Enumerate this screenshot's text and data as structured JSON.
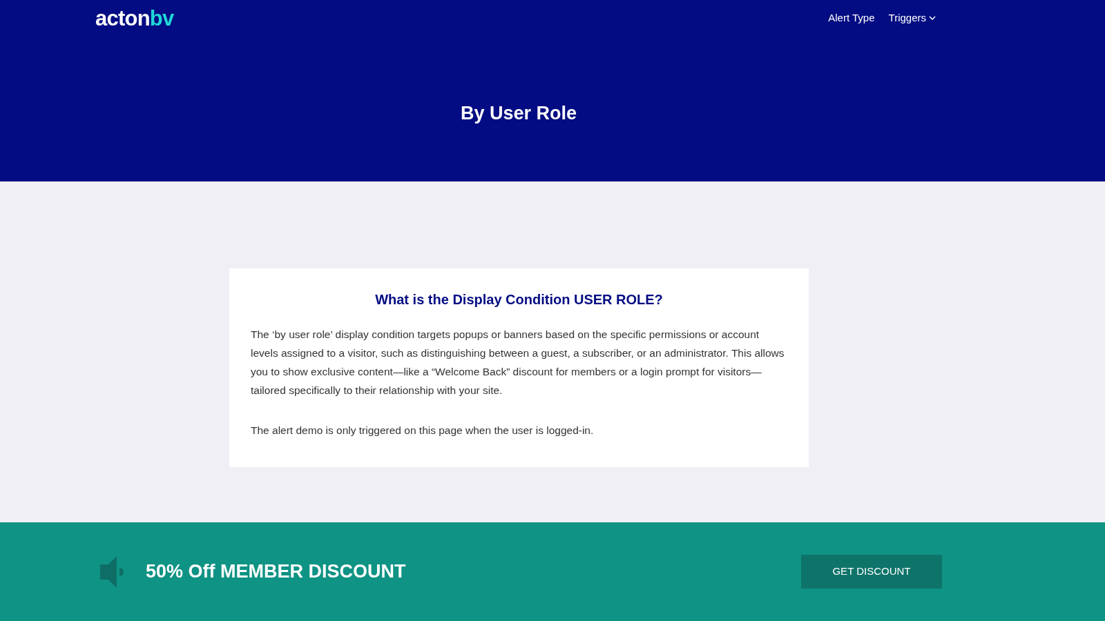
{
  "header": {
    "logo": {
      "main": "acton",
      "accent": "bv"
    },
    "nav": [
      {
        "label": "Alert Type",
        "dropdown": false
      },
      {
        "label": "Triggers",
        "dropdown": true
      }
    ],
    "title": "By User Role"
  },
  "card": {
    "heading": "What is the Display Condition USER ROLE?",
    "paragraphs": [
      "The ‘by user role’ display condition targets popups or banners based on the specific permissions or account levels assigned to a visitor, such as distinguishing between a guest, a subscriber, or an administrator. This allows you to show exclusive content—like a “Welcome Back” discount for members or a login prompt for visitors—tailored specifically to their relationship with your site.",
      "The alert demo is only triggered on this page when the user is logged-in."
    ]
  },
  "banner": {
    "text": "50% Off MEMBER DISCOUNT",
    "button": "GET DISCOUNT"
  }
}
